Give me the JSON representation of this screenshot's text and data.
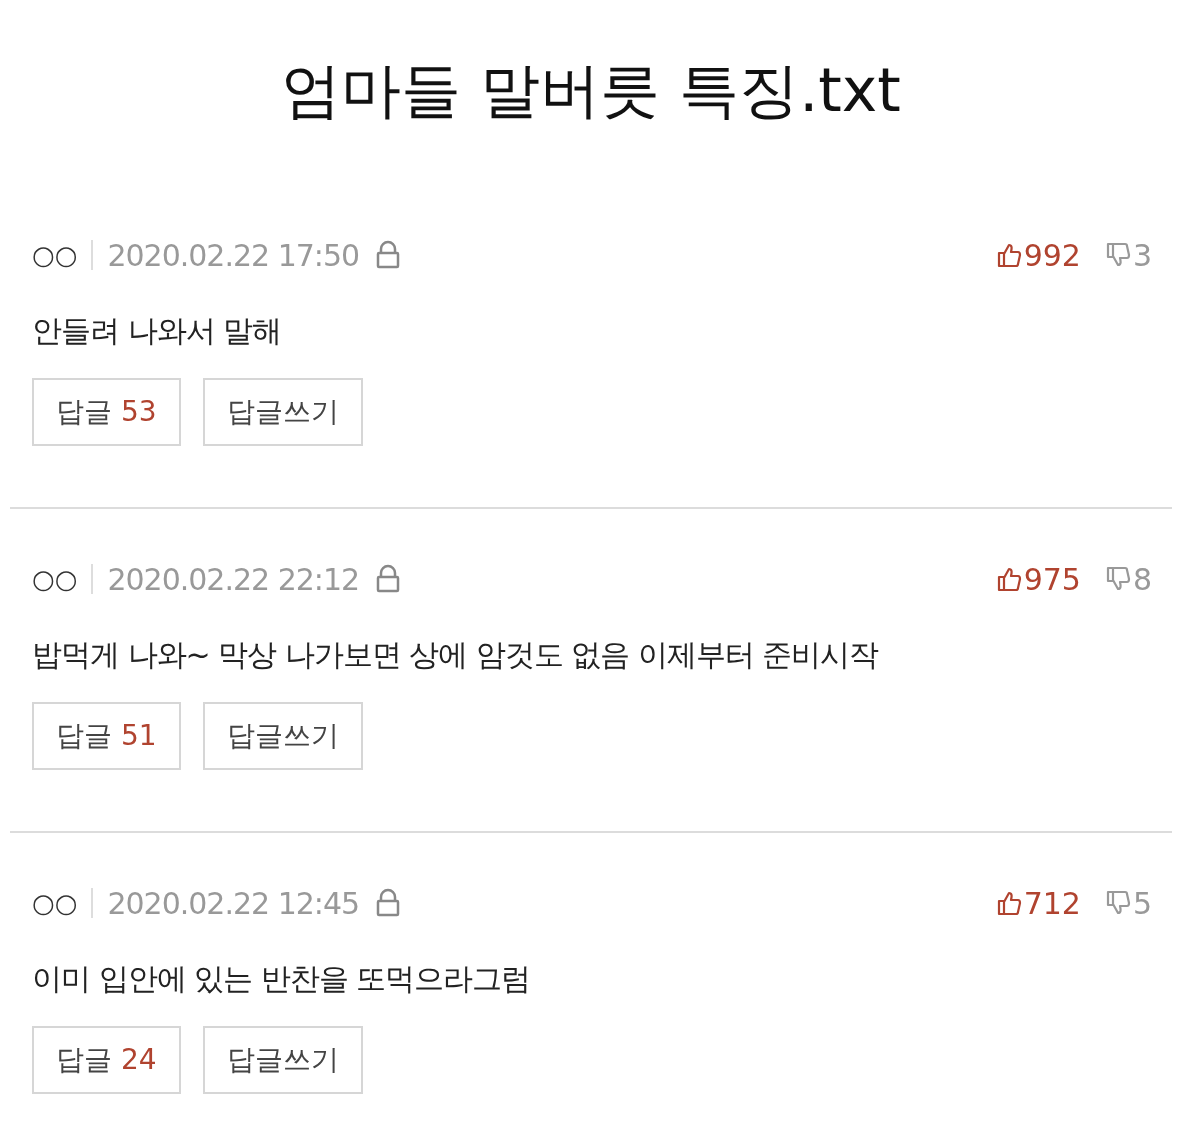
{
  "title": "엄마들 말버릇 특징.txt",
  "comments": [
    {
      "author": "○○",
      "date": "2020.02.22 17:50",
      "likes": "992",
      "dislikes": "3",
      "text": "안들려 나와서 말해",
      "reply_label": "답글",
      "reply_count": "53",
      "write_reply": "답글쓰기"
    },
    {
      "author": "○○",
      "date": "2020.02.22 22:12",
      "likes": "975",
      "dislikes": "8",
      "text": "밥먹게 나와~ 막상 나가보면 상에 암것도 없음 이제부터 준비시작",
      "reply_label": "답글",
      "reply_count": "51",
      "write_reply": "답글쓰기"
    },
    {
      "author": "○○",
      "date": "2020.02.22 12:45",
      "likes": "712",
      "dislikes": "5",
      "text": "이미 입안에 있는 반찬을 또먹으라그럼",
      "reply_label": "답글",
      "reply_count": "24",
      "write_reply": "답글쓰기"
    }
  ]
}
